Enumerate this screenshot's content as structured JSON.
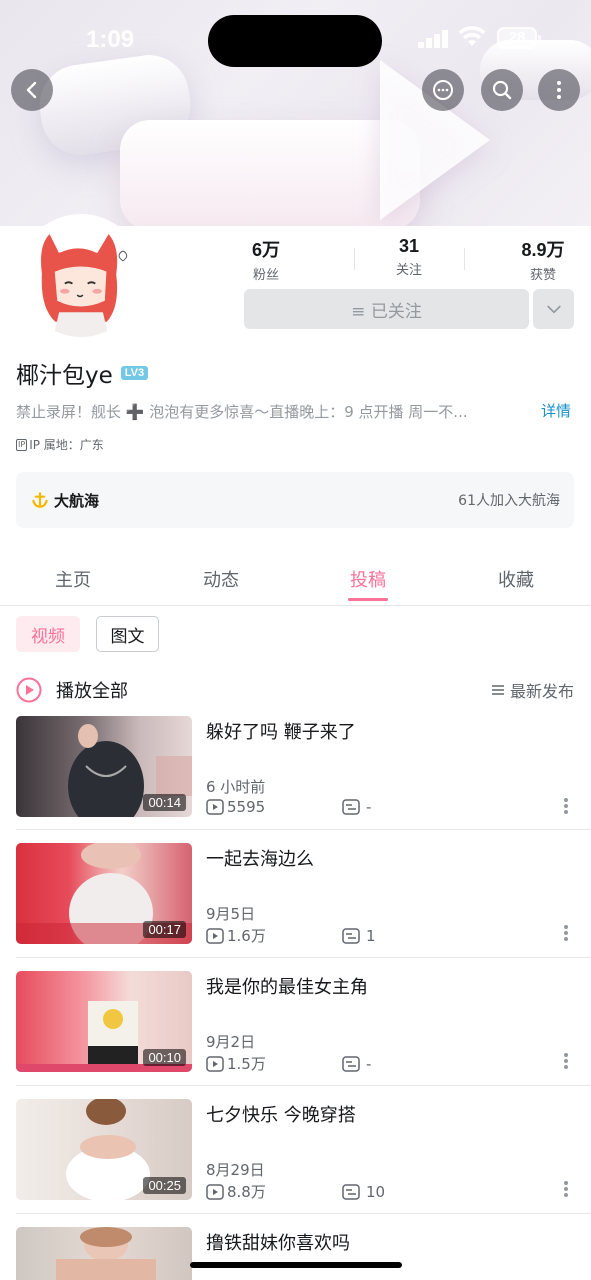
{
  "status_bar": {
    "time": "1:09",
    "battery": "28"
  },
  "profile": {
    "stats": [
      {
        "value": "6万",
        "label": "粉丝"
      },
      {
        "value": "31",
        "label": "关注"
      },
      {
        "value": "8.9万",
        "label": "获赞"
      }
    ],
    "follow_button": "≡ 已关注",
    "name": "椰汁包ye",
    "level_badge": "LV3",
    "bio": "禁止录屏！舰长 ➕ 泡泡有更多惊喜～直播晚上：9 点开播 周一不...",
    "detail_link": "详情",
    "ip_label": "IP",
    "ip_location": "IP 属地：广东"
  },
  "fleet": {
    "title": "大航海",
    "summary": "61人加入大航海"
  },
  "tabs": [
    {
      "label": "主页",
      "active": false
    },
    {
      "label": "动态",
      "active": false
    },
    {
      "label": "投稿",
      "active": true
    },
    {
      "label": "收藏",
      "active": false
    }
  ],
  "filters": {
    "video": "视频",
    "article": "图文"
  },
  "play_all": {
    "label": "播放全部",
    "sort_label": "最新发布"
  },
  "videos": [
    {
      "title": "躲好了吗 鞭子来了",
      "date": "6 小时前",
      "plays": "5595",
      "danmaku": "-",
      "duration": "00:14"
    },
    {
      "title": "一起去海边么",
      "date": "9月5日",
      "plays": "1.6万",
      "danmaku": "1",
      "duration": "00:17"
    },
    {
      "title": "我是你的最佳女主角",
      "date": "9月2日",
      "plays": "1.5万",
      "danmaku": "-",
      "duration": "00:10"
    },
    {
      "title": "七夕快乐 今晚穿搭",
      "date": "8月29日",
      "plays": "8.8万",
      "danmaku": "10",
      "duration": "00:25"
    },
    {
      "title": "撸铁甜妹你喜欢吗",
      "date": "",
      "plays": "",
      "danmaku": "",
      "duration": ""
    }
  ],
  "colors": {
    "accent": "#fb7299",
    "link": "#1890c8",
    "muted": "#9499a0"
  }
}
